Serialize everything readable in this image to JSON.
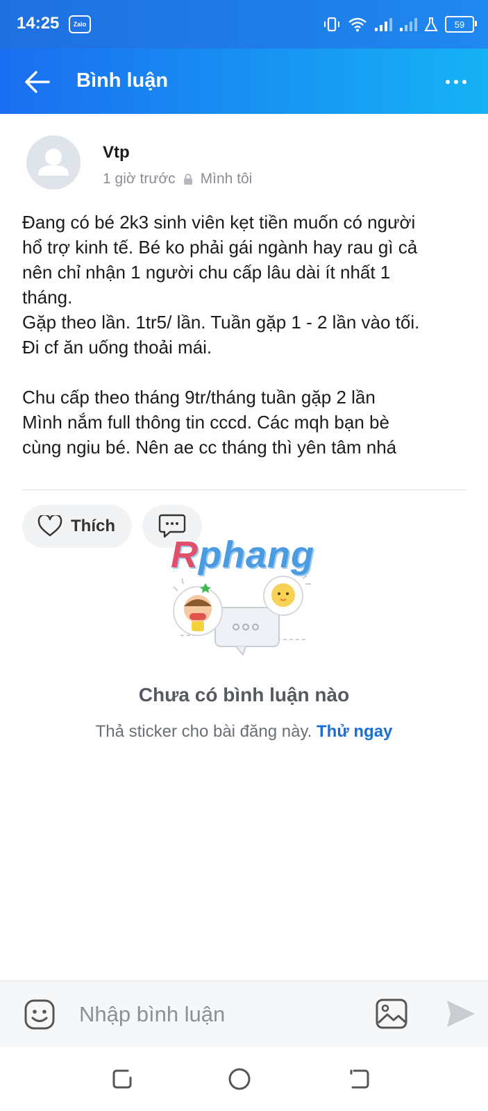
{
  "status_bar": {
    "time": "14:25",
    "app_badge": "Zalo",
    "battery": "59"
  },
  "app_bar": {
    "title": "Bình luận"
  },
  "post": {
    "author": "Vtp",
    "time_ago": "1 giờ trước",
    "privacy": "Mình tôi",
    "text": "Đang có bé 2k3 sinh viên kẹt tiền muốn có người\nhổ trợ kinh tế. Bé ko phải gái ngành hay rau gì cả\nnên chỉ nhận 1 người chu cấp lâu dài ít nhất 1\ntháng.\nGặp theo lần. 1tr5/ lần. Tuần gặp 1 - 2 lần vào tối.\nĐi cf ăn uống thoải mái.\n\nChu cấp theo tháng 9tr/tháng tuần gặp 2 lần\nMình nắm full thông tin cccd. Các mqh bạn bè\ncùng ngiu bé. Nên ae cc tháng thì yên tâm nhá"
  },
  "actions": {
    "like_label": "Thích"
  },
  "watermark": {
    "first": "R",
    "rest": "phang"
  },
  "empty_state": {
    "title": "Chưa có bình luận nào",
    "subtitle": "Thả sticker cho bài đăng này. ",
    "link": "Thử ngay"
  },
  "composer": {
    "placeholder": "Nhập bình luận"
  },
  "colors": {
    "accent": "#1a6ef0",
    "link": "#1a6fd6"
  },
  "icons": [
    "back-arrow-icon",
    "more-icon",
    "lock-icon",
    "heart-icon",
    "comment-icon",
    "emoji-icon",
    "image-icon",
    "send-icon",
    "recent-apps-icon",
    "home-icon",
    "back-nav-icon"
  ]
}
